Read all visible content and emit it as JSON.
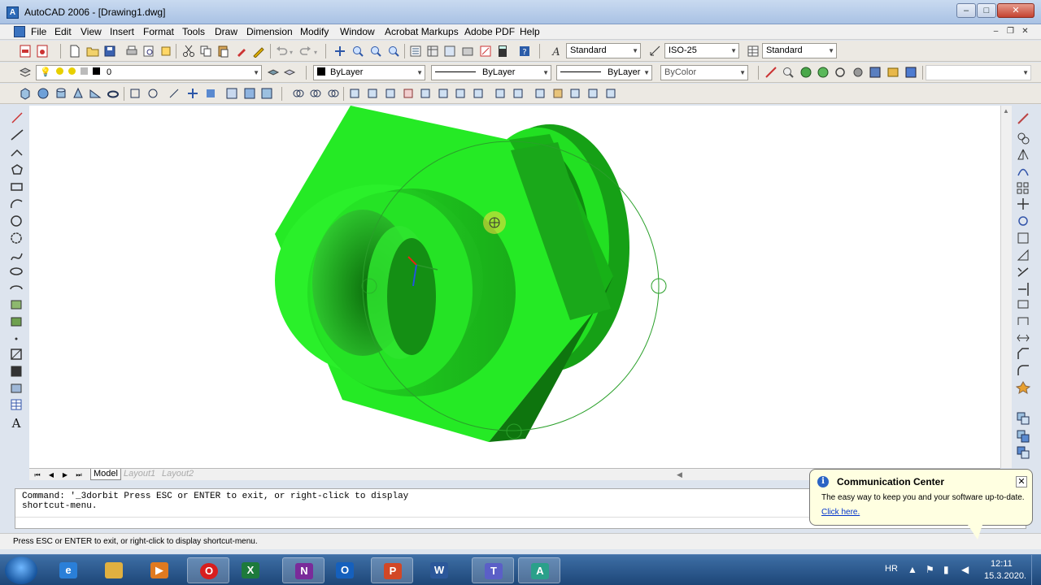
{
  "window": {
    "title": "AutoCAD 2006 - [Drawing1.dwg]"
  },
  "menu": [
    "File",
    "Edit",
    "View",
    "Insert",
    "Format",
    "Tools",
    "Draw",
    "Dimension",
    "Modify",
    "Window",
    "Acrobat Markups",
    "Adobe PDF",
    "Help"
  ],
  "styles": {
    "text_style": "Standard",
    "dim_style": "ISO-25",
    "table_style": "Standard"
  },
  "layers": {
    "current_layer": "0",
    "color": "ByLayer",
    "linetype": "ByLayer",
    "lineweight": "ByLayer",
    "plot_style": "ByColor"
  },
  "layout_tabs": [
    "Model",
    "Layout1",
    "Layout2"
  ],
  "command": {
    "line1": "Command: '_3dorbit Press ESC or ENTER to exit, or right-click to display",
    "line2": "shortcut-menu."
  },
  "status": {
    "prompt": "Press ESC or ENTER to exit, or right-click to display shortcut-menu."
  },
  "comm_center": {
    "title": "Communication Center",
    "text": "The easy way to keep you and your software up-to-date.",
    "link": "Click here."
  },
  "taskbar": {
    "lang": "HR",
    "time": "12:11",
    "date": "15.3.2020.",
    "apps": [
      "internet-explorer",
      "file-explorer",
      "media-player",
      "opera",
      "excel",
      "onenote",
      "outlook",
      "powerpoint",
      "word",
      "teams",
      "autocad"
    ]
  },
  "colors": {
    "model_green": "#22ee22",
    "accent": "#2b64c4"
  }
}
